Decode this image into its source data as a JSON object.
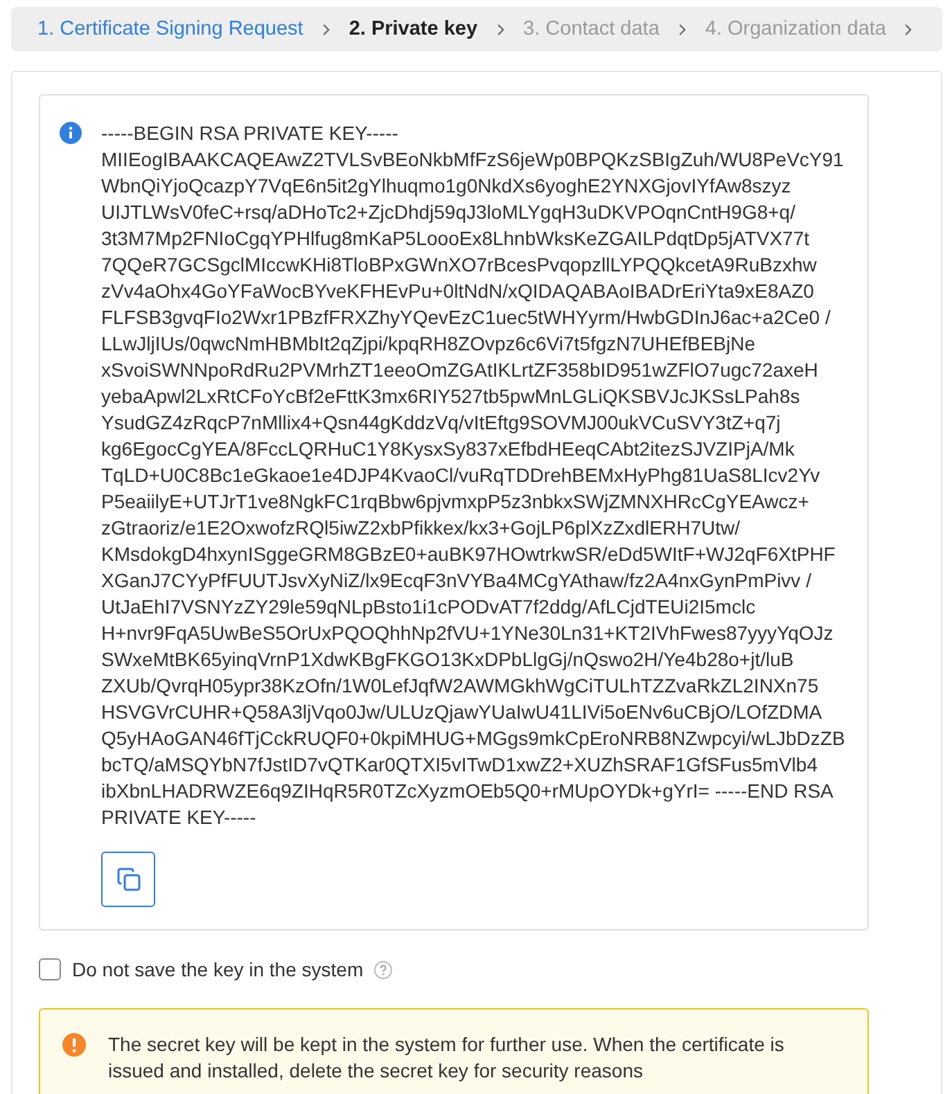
{
  "steps": [
    {
      "label": "1. Certificate Signing Request",
      "completed": true,
      "disabled": false,
      "selected": false
    },
    {
      "label": "2. Private key",
      "completed": false,
      "disabled": false,
      "selected": true
    },
    {
      "label": "3. Contact data",
      "completed": false,
      "disabled": true,
      "selected": false
    },
    {
      "label": "4. Organization data",
      "completed": false,
      "disabled": true,
      "selected": false
    }
  ],
  "key_box": {
    "lines": [
      "-----BEGIN RSA PRIVATE KEY-----",
      "MIIEogIBAAKCAQEAwZ2TVLSvBEoNkbMfFzS6jeWp0BPQKzSBIgZuh/WU8PeVcY91",
      "WbnQiYjoQcazpY7VqE6n5it2gYlhuqmo1g0NkdXs6yoghE2YNXGjovIYfAw8szyz",
      "UIJTLWsV0feC+rsq/aDHoTc2+ZjcDhdj59qJ3loMLYgqH3uDKVPOqnCntH9G8+q/",
      "3t3M7Mp2FNIoCgqYPHlfug8mKaP5LoooEx8LhnbWksKeZGAILPdqtDp5jATVX77t",
      "7QQeR7GCSgclMIccwKHi8TloBPxGWnXO7rBcesPvqopzllLYPQQkcetA9RuBzxhw",
      "zVv4aOhx4GoYFaWocBYveKFHEvPu+0ltNdN/xQIDAQABAoIBADrEriYta9xE8AZ0",
      "FLFSB3gvqFIo2Wxr1PBzfFRXZhyYQevEzC1uec5tWHYyrm/HwbGDInJ6ac+a2Ce0 /",
      "LLwJljIUs/0qwcNmHBMbIt2qZjpi/kpqRH8ZOvpz6c6Vi7t5fgzN7UHEfBEBjNe",
      "xSvoiSWNNpoRdRu2PVMrhZT1eeoOmZGAtIKLrtZF358bID951wZFlO7ugc72axeH",
      "yebaApwl2LxRtCFoYcBf2eFttK3mx6RIY527tb5pwMnLGLiQKSBVJcJKSsLPah8s",
      "YsudGZ4zRqcP7nMllix4+Qsn44gKddzVq/vItEftg9SOVMJ00ukVCuSVY3tZ+q7j",
      "kg6EgocCgYEA/8FccLQRHuC1Y8KysxSy837xEfbdHEeqCAbt2itezSJVZIPjA/Mk",
      "TqLD+U0C8Bc1eGkaoe1e4DJP4KvaoCl/vuRqTDDrehBEMxHyPhg81UaS8LIcv2Yv",
      "P5eaiilyE+UTJrT1ve8NgkFC1rqBbw6pjvmxpP5z3nbkxSWjZMNXHRcCgYEAwcz+",
      "zGtraoriz/e1E2OxwofzRQl5iwZ2xbPfikkex/kx3+GojLP6plXzZxdlERH7Utw/",
      "KMsdokgD4hxynISggeGRM8GBzE0+auBK97HOwtrkwSR/eDd5WItF+WJ2qF6XtPHF",
      "XGanJ7CYyPfFUUTJsvXyNiZ/lx9EcqF3nVYBa4MCgYAthaw/fz2A4nxGynPmPivv /",
      "UtJaEhI7VSNYzZY29le59qNLpBsto1i1cPODvAT7f2ddg/AfLCjdTEUi2I5mclc",
      "H+nvr9FqA5UwBeS5OrUxPQOQhhNp2fVU+1YNe30Ln31+KT2IVhFwes87yyyYqOJz",
      "SWxeMtBK65yinqVrnP1XdwKBgFKGO13KxDPbLlgGj/nQswo2H/Ye4b28o+jt/luB",
      "ZXUb/QvrqH05ypr38KzOfn/1W0LefJqfW2AWMGkhWgCiTULhTZZvaRkZL2INXn75",
      "HSVGVrCUHR+Q58A3ljVqo0Jw/ULUzQjawYUaIwU41LIVi5oENv6uCBjO/LOfZDMA",
      "Q5yHAoGAN46fTjCckRUQF0+0kpiMHUG+MGgs9mkCpEroNRB8NZwpcyi/wLJbDzZB",
      "bcTQ/aMSQYbN7fJstID7vQTKar0QTXI5vITwD1xwZ2+XUZhSRAF1GfSFus5mVlb4",
      "ibXbnLHADRWZE6q9ZIHqR5R0TZcXyzmOEb5Q0+rMUpOYDk+gYrI= -----END RSA",
      "PRIVATE KEY-----"
    ]
  },
  "save_option": {
    "label": "Do not save the key in the system",
    "checked": false
  },
  "warning": {
    "text": "The secret key will be kept in the system for further use. When the certificate is issued and installed, delete the secret key for security reasons"
  }
}
